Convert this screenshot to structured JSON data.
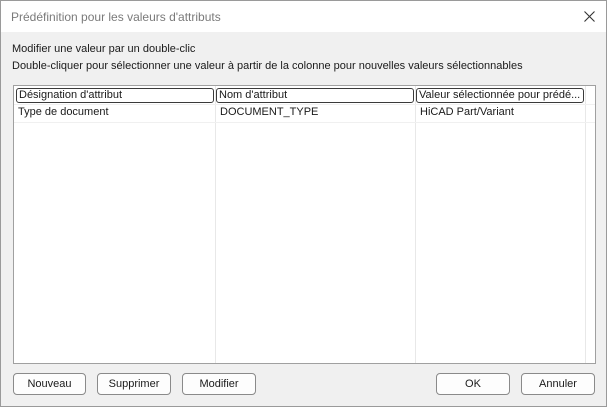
{
  "window": {
    "title": "Prédéfinition pour les valeurs d'attributs"
  },
  "instructions": {
    "line1": "Modifier une valeur par un double-clic",
    "line2": "Double-cliquer pour sélectionner une valeur à partir de la colonne pour nouvelles valeurs sélectionnables"
  },
  "table": {
    "columns": [
      "Désignation d'attribut",
      "Nom d'attribut",
      "Valeur sélectionnée pour prédé..."
    ],
    "rows": [
      [
        "Type de document",
        "DOCUMENT_TYPE",
        "HiCAD Part/Variant"
      ]
    ]
  },
  "buttons": {
    "new": "Nouveau",
    "delete": "Supprimer",
    "modify": "Modifier",
    "ok": "OK",
    "cancel": "Annuler"
  },
  "icons": {
    "close": "close-icon"
  }
}
